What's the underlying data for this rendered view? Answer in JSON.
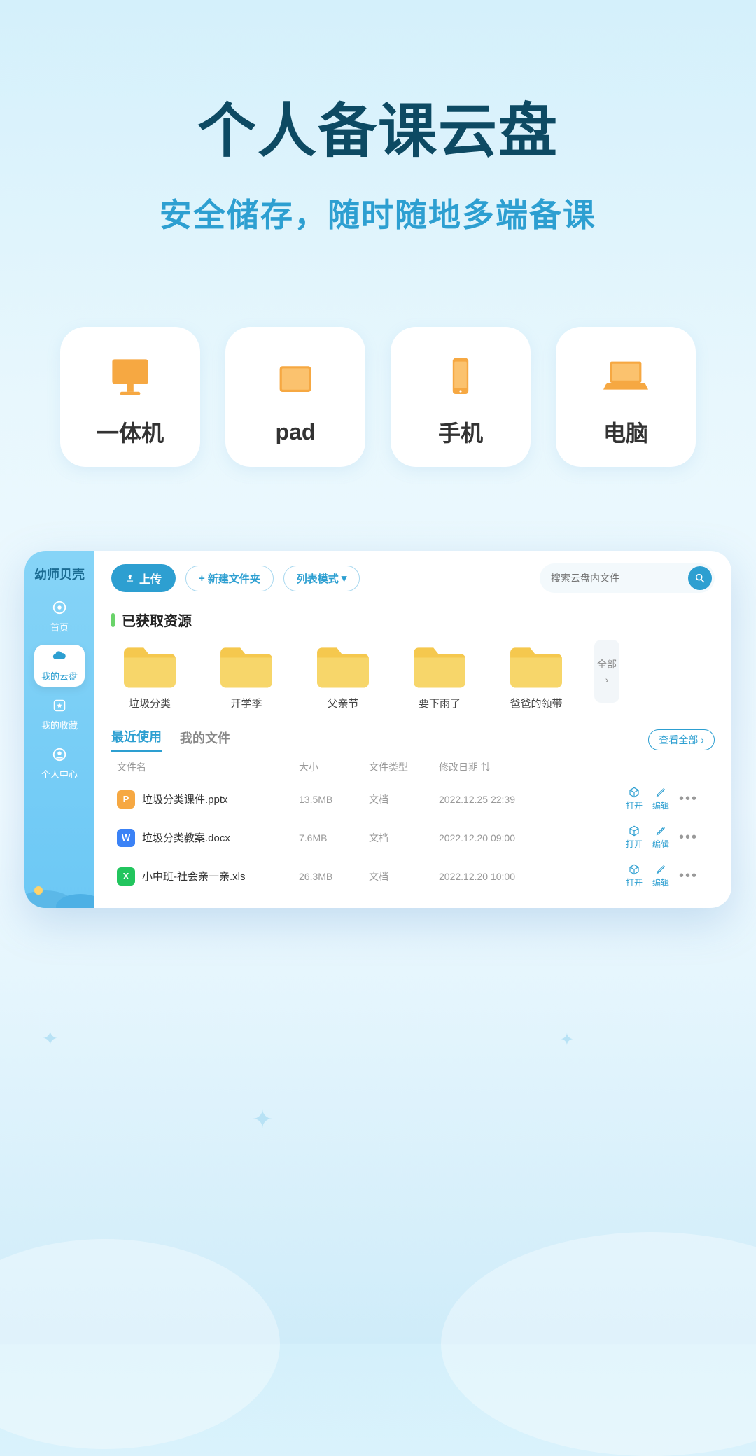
{
  "hero": {
    "title": "个人备课云盘",
    "subtitle": "安全储存，随时随地多端备课"
  },
  "devices": [
    {
      "label": "一体机",
      "icon": "desktop"
    },
    {
      "label": "pad",
      "icon": "tablet"
    },
    {
      "label": "手机",
      "icon": "phone"
    },
    {
      "label": "电脑",
      "icon": "laptop"
    }
  ],
  "sidebar": {
    "brand": "幼师贝壳",
    "items": [
      {
        "label": "首页",
        "icon": "home"
      },
      {
        "label": "我的云盘",
        "icon": "cloud",
        "active": true
      },
      {
        "label": "我的收藏",
        "icon": "star"
      },
      {
        "label": "个人中心",
        "icon": "user"
      }
    ]
  },
  "toolbar": {
    "upload": "上传",
    "new_folder": "新建文件夹",
    "list_mode": "列表模式",
    "search_placeholder": "搜索云盘内文件"
  },
  "resources": {
    "title": "已获取资源",
    "folders": [
      {
        "name": "垃圾分类"
      },
      {
        "name": "开学季"
      },
      {
        "name": "父亲节"
      },
      {
        "name": "要下雨了"
      },
      {
        "name": "爸爸的领带"
      }
    ],
    "all_label": "全部"
  },
  "tabs": {
    "recent": "最近使用",
    "my_files": "我的文件",
    "view_all": "查看全部"
  },
  "table": {
    "headers": {
      "name": "文件名",
      "size": "大小",
      "type": "文件类型",
      "date": "修改日期"
    },
    "actions": {
      "open": "打开",
      "edit": "编辑"
    },
    "rows": [
      {
        "badge": "P",
        "badge_color": "#f6a842",
        "name": "垃圾分类课件.pptx",
        "size": "13.5MB",
        "type": "文档",
        "date": "2022.12.25 22:39"
      },
      {
        "badge": "W",
        "badge_color": "#3b82f6",
        "name": "垃圾分类教案.docx",
        "size": "7.6MB",
        "type": "文档",
        "date": "2022.12.20 09:00"
      },
      {
        "badge": "X",
        "badge_color": "#22c55e",
        "name": "小中班-社会亲一亲.xls",
        "size": "26.3MB",
        "type": "文档",
        "date": "2022.12.20 10:00"
      }
    ]
  }
}
